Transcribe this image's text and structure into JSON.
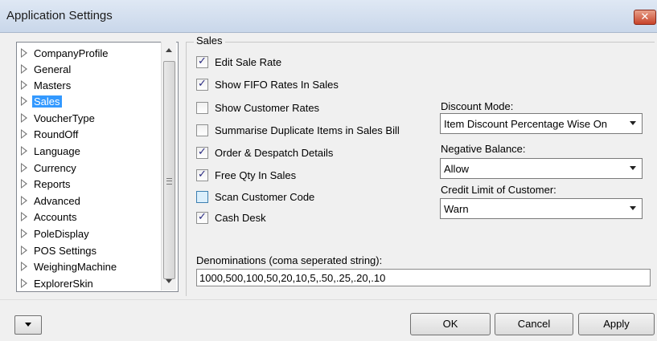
{
  "window": {
    "title": "Application Settings",
    "close_symbol": "✕"
  },
  "tree": {
    "items": [
      {
        "label": "CompanyProfile"
      },
      {
        "label": "General"
      },
      {
        "label": "Masters"
      },
      {
        "label": "Sales",
        "selected": true
      },
      {
        "label": "VoucherType"
      },
      {
        "label": "RoundOff"
      },
      {
        "label": "Language"
      },
      {
        "label": "Currency"
      },
      {
        "label": "Reports"
      },
      {
        "label": "Advanced"
      },
      {
        "label": "Accounts"
      },
      {
        "label": "PoleDisplay"
      },
      {
        "label": "POS Settings"
      },
      {
        "label": "WeighingMachine"
      },
      {
        "label": "ExplorerSkin"
      }
    ]
  },
  "sales": {
    "group_title": "Sales",
    "checkboxes": [
      {
        "label": "Edit Sale Rate",
        "checked": true
      },
      {
        "label": "Show FIFO Rates In Sales",
        "checked": true
      },
      {
        "label": "Show Customer Rates",
        "checked": false
      },
      {
        "label": "Summarise Duplicate Items in Sales Bill",
        "checked": false
      },
      {
        "label": "Order & Despatch Details",
        "checked": true
      },
      {
        "label": "Free Qty In Sales",
        "checked": true
      },
      {
        "label": "Scan Customer Code",
        "checked": false
      },
      {
        "label": "Cash Desk",
        "checked": true
      }
    ],
    "discount_mode": {
      "label": "Discount Mode:",
      "value": "Item Discount Percentage Wise On"
    },
    "negative_balance": {
      "label": "Negative Balance:",
      "value": "Allow"
    },
    "credit_limit": {
      "label": "Credit Limit of Customer:",
      "value": "Warn"
    },
    "denominations": {
      "label": "Denominations (coma seperated string):",
      "value": "1000,500,100,50,20,10,5,.50,.25,.20,.10"
    }
  },
  "footer": {
    "ok_label": "OK",
    "cancel_label": "Cancel",
    "apply_label": "Apply"
  },
  "colors": {
    "selection": "#3399ff",
    "title_bar": "#c9d7ea",
    "close_button": "#c7432a"
  }
}
